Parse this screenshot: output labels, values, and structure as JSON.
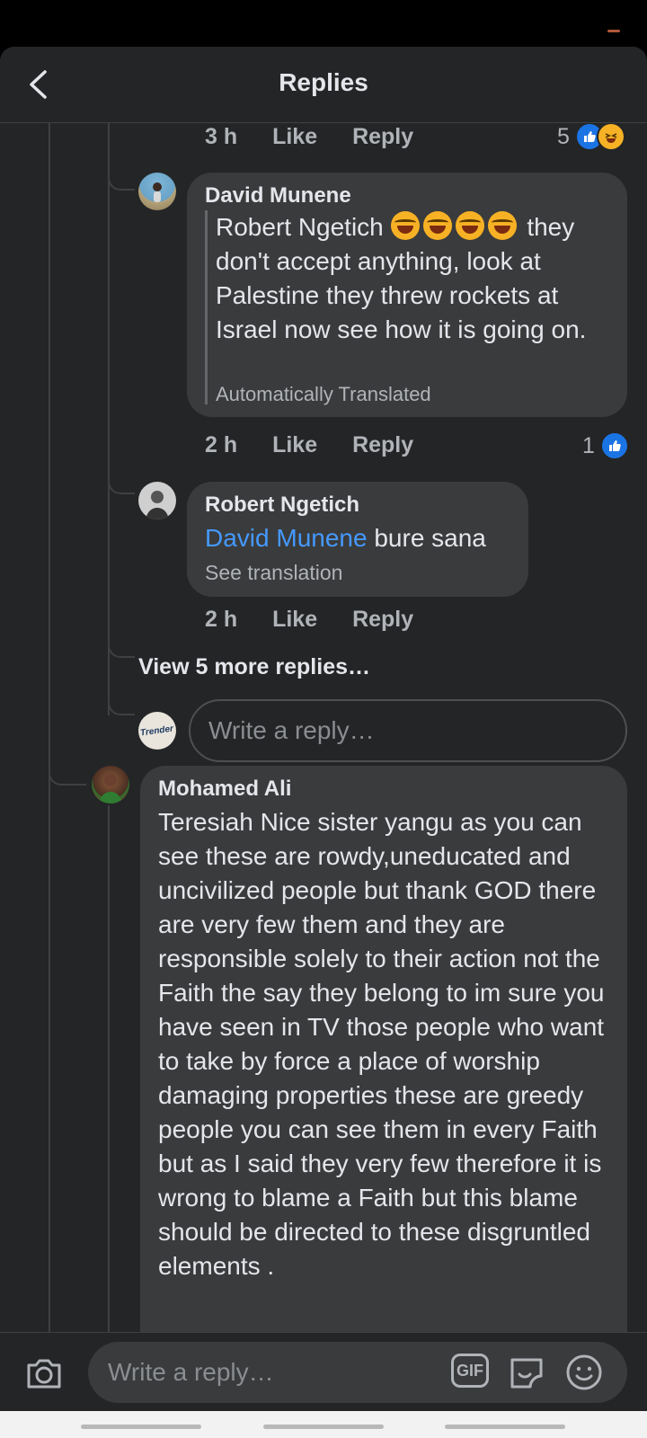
{
  "header": {
    "title": "Replies"
  },
  "comments": [
    {
      "time": "3 h",
      "like_label": "Like",
      "reply_label": "Reply",
      "reaction_count": "5"
    },
    {
      "author": "David Munene",
      "text_mention": "Robert Ngetich",
      "text": "they don't accept anything, look at Palestine they threw rockets at Israel now see how it is going on.",
      "note": "Automatically Translated",
      "time": "2 h",
      "like_label": "Like",
      "reply_label": "Reply",
      "reaction_count": "1"
    },
    {
      "author": "Robert Ngetich",
      "text_mention": "David Munene",
      "text": "bure sana",
      "note": "See translation",
      "time": "2 h",
      "like_label": "Like",
      "reply_label": "Reply"
    },
    {
      "author": "Mohamed Ali",
      "text": "Teresiah Nice sister yangu as you can see these are rowdy,uneducated and uncivilized people but thank GOD there are very few them and they are responsible solely to their action not the Faith the say they belong to im sure you have seen in TV those people who want to take by force a place of worship damaging properties these are greedy people you can see them in every Faith but as I said they very few therefore it is wrong to blame a Faith but this blame should be directed to these disgruntled elements ."
    }
  ],
  "view_more": "View 5 more replies…",
  "reply_box": {
    "placeholder": "Write a reply…",
    "avatar_text": "Trender"
  },
  "composer": {
    "placeholder": "Write a reply…",
    "gif_label": "GIF"
  },
  "colors": {
    "background": "#242526",
    "bubble": "#3a3b3c",
    "mention": "#4599ff",
    "like": "#1b74e4"
  }
}
